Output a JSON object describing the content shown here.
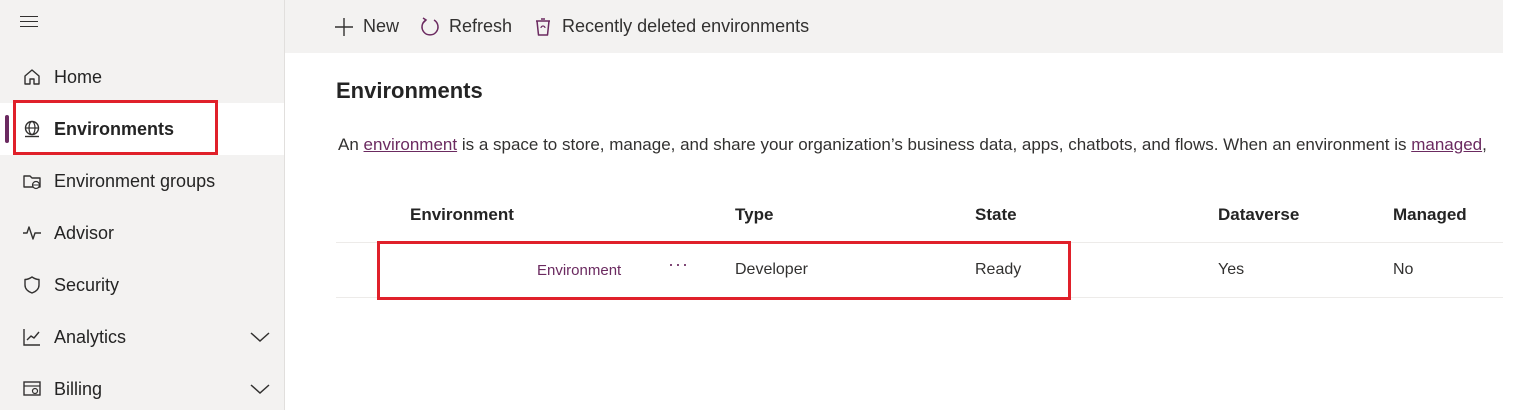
{
  "sidebar": {
    "items": [
      {
        "label": "Home",
        "icon": "home-icon"
      },
      {
        "label": "Environments",
        "icon": "globe-icon",
        "selected": true
      },
      {
        "label": "Environment groups",
        "icon": "folder-globe-icon"
      },
      {
        "label": "Advisor",
        "icon": "pulse-icon"
      },
      {
        "label": "Security",
        "icon": "shield-icon"
      },
      {
        "label": "Analytics",
        "icon": "chart-icon",
        "expandable": true
      },
      {
        "label": "Billing",
        "icon": "billing-icon",
        "expandable": true
      }
    ]
  },
  "toolbar": {
    "new_label": "New",
    "refresh_label": "Refresh",
    "recently_deleted_label": "Recently deleted environments"
  },
  "main": {
    "title": "Environments",
    "description": {
      "part1": "An ",
      "link1": "environment",
      "part2": " is a space to store, manage, and share your organization’s business data, apps, chatbots, and flows. When an environment is ",
      "link2": "managed",
      "part3": ","
    }
  },
  "table": {
    "columns": [
      "Environment",
      "Type",
      "State",
      "Dataverse",
      "Managed"
    ],
    "rows": [
      {
        "environment": "Environment",
        "more": "···",
        "type": "Developer",
        "state": "Ready",
        "dataverse": "Yes",
        "managed": "No"
      }
    ]
  },
  "colors": {
    "accent": "#6b2a60",
    "highlight": "#e0202a",
    "sidebar_bg": "#f3f2f1"
  }
}
